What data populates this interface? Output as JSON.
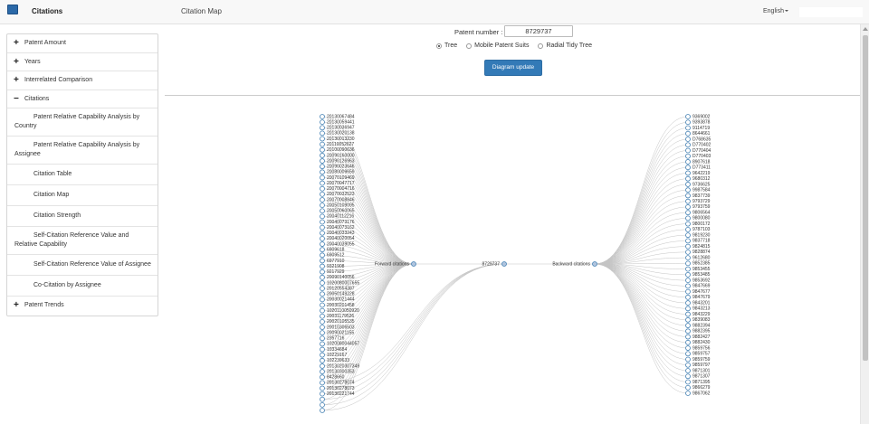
{
  "app": {
    "brand": "Citations",
    "section_title": "Citation Map",
    "language": "English"
  },
  "sidebar": {
    "items": [
      {
        "label": "Patent Amount",
        "sign": "+",
        "type": "top"
      },
      {
        "label": "Years",
        "sign": "+",
        "type": "top"
      },
      {
        "label": "Interrelated Comparison",
        "sign": "+",
        "type": "top"
      },
      {
        "label": "Citations",
        "sign": "−",
        "type": "top"
      },
      {
        "label": "Patent Relative Capability Analysis by Country",
        "type": "sub"
      },
      {
        "label": "Patent Relative Capability Analysis by Assignee",
        "type": "sub"
      },
      {
        "label": "Citation Table",
        "type": "sub"
      },
      {
        "label": "Citation Map",
        "type": "sub"
      },
      {
        "label": "Citation Strength",
        "type": "sub"
      },
      {
        "label": "Self-Citation Reference Value and Relative Capability",
        "type": "sub"
      },
      {
        "label": "Self-Citation Reference Value of Assignee",
        "type": "sub"
      },
      {
        "label": "Co-Citation by Assignee",
        "type": "sub"
      },
      {
        "label": "Patent Trends",
        "sign": "+",
        "type": "top"
      }
    ]
  },
  "form": {
    "patent_label": "Patent number :",
    "patent_value": "8729737",
    "radios": [
      {
        "label": "Tree",
        "checked": true
      },
      {
        "label": "Mobile Patent Suits",
        "checked": false
      },
      {
        "label": "Radial Tidy Tree",
        "checked": false
      }
    ],
    "update_button": "Diagram update"
  },
  "tree": {
    "root": "8729737",
    "forward_label": "Forward citations",
    "backward_label": "Backward citations",
    "forward": [
      "20130067484",
      "20130059441",
      "20130036947",
      "20130020138",
      "20130013230",
      "20110052627",
      "20100090636",
      "20090160000",
      "20090126963",
      "20090023646",
      "20080009659",
      "20070109469",
      "20070047717",
      "20070004716",
      "20070032523",
      "20070008846",
      "20050109095",
      "20050060065",
      "20040112216",
      "20040073176",
      "20040073162",
      "20040033243",
      "20040020054",
      "20040039055",
      "6909618",
      "6909512",
      "6977910",
      "9321908",
      "9217929",
      "20090140056",
      "1020080007655",
      "20120554387",
      "20050149228",
      "20030021444",
      "20030201458",
      "1020110050920",
      "20031179526",
      "20020105535",
      "20010306503",
      "20090021155",
      "2357716",
      "1020080044057",
      "10334684",
      "10229167",
      "102239633",
      "2013020307349",
      "20130300353",
      "8428660",
      "20130278074",
      "20130278073",
      "20130221744",
      "",
      "",
      ""
    ],
    "backward": [
      "9369002",
      "9393878",
      "9114719",
      "8644661",
      "D768635",
      "D770402",
      "D770404",
      "D770403",
      "8907618",
      "D773411",
      "9642219",
      "9680312",
      "9736625",
      "9987584",
      "9837739",
      "9793729",
      "9793759",
      "9806564",
      "9800080",
      "9800172",
      "9787103",
      "9819230",
      "9837718",
      "9824815",
      "9828874",
      "9612680",
      "9852385",
      "9853455",
      "9853485",
      "9853692",
      "9847669",
      "9847677",
      "9847679",
      "9843201",
      "9843213",
      "9843229",
      "9839083",
      "9882394",
      "9882395",
      "9882427",
      "9882430",
      "9859756",
      "9859757",
      "9859759",
      "9859797",
      "9871301",
      "9871307",
      "9871395",
      "9866279",
      "9867062"
    ]
  }
}
